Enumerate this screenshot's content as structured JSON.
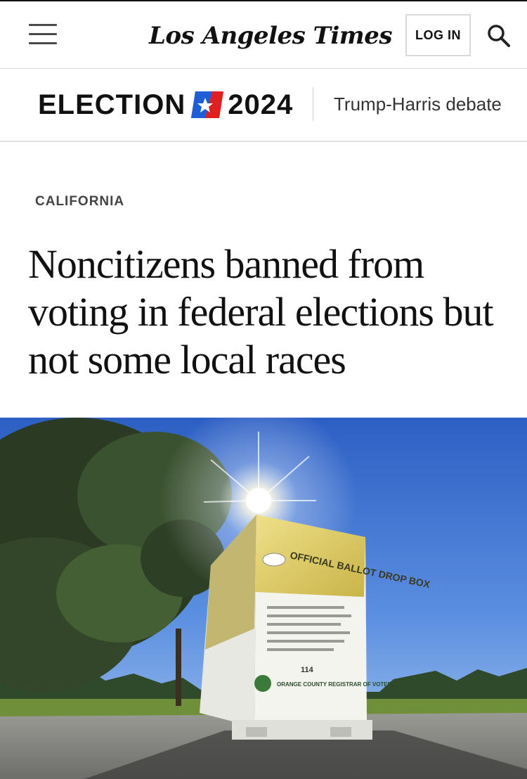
{
  "header": {
    "logo_text": "Los Angeles Times",
    "login_label": "LOG IN"
  },
  "election_bar": {
    "label_left": "ELECTION",
    "label_year": "2024",
    "nav_items": [
      "Trump-Harris debate"
    ]
  },
  "article": {
    "section": "CALIFORNIA",
    "headline": "Noncitizens banned from voting in federal elections but not some local races"
  },
  "hero_image": {
    "box_label": "OFFICIAL BALLOT DROP BOX",
    "box_number": "114",
    "box_registrar": "ORANGE COUNTY REGISTRAR OF VOTERS"
  },
  "colors": {
    "flag_blue": "#1f5fd6",
    "flag_red": "#e02020",
    "sky_top": "#2d63c8",
    "box_yellow": "#d9c95a"
  },
  "icons": [
    "hamburger-menu-icon",
    "search-icon",
    "election-flag-icon"
  ]
}
